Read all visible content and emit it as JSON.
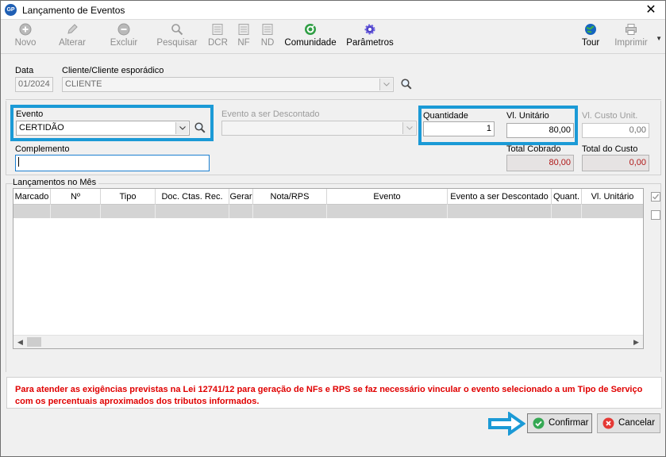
{
  "window": {
    "title": "Lançamento de Eventos",
    "logo_text": "GP",
    "close_glyph": "✕"
  },
  "toolbar": {
    "items": [
      {
        "label": "Novo",
        "icon": "plus-circle-icon",
        "enabled": false
      },
      {
        "label": "Alterar",
        "icon": "pencil-icon",
        "enabled": false
      },
      {
        "label": "Excluir",
        "icon": "minus-circle-icon",
        "enabled": false
      },
      {
        "label": "Pesquisar",
        "icon": "search-icon",
        "enabled": false
      },
      {
        "label": "DCR",
        "icon": "document-icon",
        "enabled": false
      },
      {
        "label": "NF",
        "icon": "document-icon",
        "enabled": false
      },
      {
        "label": "ND",
        "icon": "document-icon",
        "enabled": false
      },
      {
        "label": "Comunidade",
        "icon": "community-icon",
        "enabled": true
      },
      {
        "label": "Parâmetros",
        "icon": "gear-icon",
        "enabled": true
      },
      {
        "label": "Tour",
        "icon": "globe-icon",
        "enabled": true
      },
      {
        "label": "Imprimir",
        "icon": "printer-icon",
        "enabled": false
      }
    ]
  },
  "form": {
    "data_label": "Data",
    "data_value": "01/2024",
    "cliente_label": "Cliente/Cliente esporádico",
    "cliente_value": "CLIENTE",
    "evento_label": "Evento",
    "evento_value": "CERTIDÃO",
    "evento_desc_label": "Evento a ser Descontado",
    "evento_desc_value": "",
    "quantidade_label": "Quantidade",
    "quantidade_value": "1",
    "vl_unitario_label": "Vl. Unitário",
    "vl_unitario_value": "80,00",
    "vl_custo_label": "Vl. Custo Unit.",
    "vl_custo_value": "0,00",
    "complemento_label": "Complemento",
    "complemento_value": "",
    "total_cobrado_label": "Total Cobrado",
    "total_cobrado_value": "80,00",
    "total_custo_label": "Total do Custo",
    "total_custo_value": "0,00"
  },
  "grid": {
    "title": "Lançamentos no Mês",
    "columns": [
      "Marcado",
      "Nº",
      "Tipo",
      "Doc. Ctas. Rec.",
      "Gerar",
      "Nota/RPS",
      "Evento",
      "Evento a ser Descontado",
      "Quant.",
      "Vl. Unitário"
    ],
    "rows": []
  },
  "warning": {
    "text": "Para atender as exigências previstas na Lei 12741/12 para geração de NFs e RPS se faz necessário vincular o evento selecionado a um Tipo de Serviço com os percentuais aproximados dos tributos informados."
  },
  "buttons": {
    "confirm_label": "Confirmar",
    "cancel_label": "Cancelar"
  },
  "colors": {
    "highlight": "#1b9ad6",
    "warning_text": "#e00000",
    "computed_value": "#b01818"
  }
}
